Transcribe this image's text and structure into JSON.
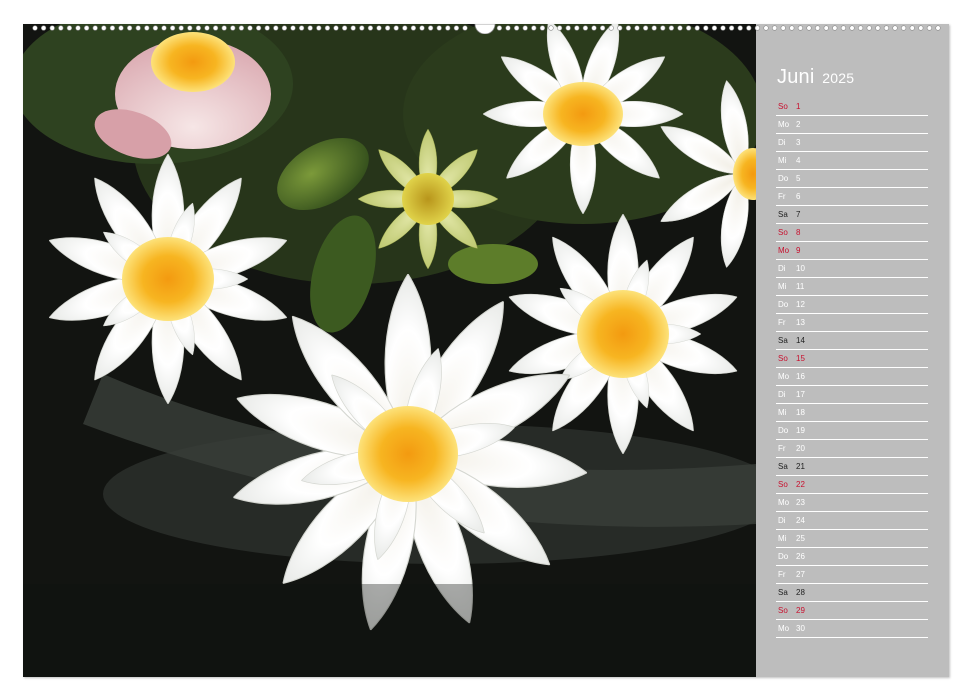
{
  "calendar": {
    "month": "Juni",
    "year": "2025",
    "days": [
      {
        "wd": "So",
        "d": "1",
        "type": "sun"
      },
      {
        "wd": "Mo",
        "d": "2",
        "type": "day"
      },
      {
        "wd": "Di",
        "d": "3",
        "type": "day"
      },
      {
        "wd": "Mi",
        "d": "4",
        "type": "day"
      },
      {
        "wd": "Do",
        "d": "5",
        "type": "day"
      },
      {
        "wd": "Fr",
        "d": "6",
        "type": "day"
      },
      {
        "wd": "Sa",
        "d": "7",
        "type": "sat"
      },
      {
        "wd": "So",
        "d": "8",
        "type": "sun"
      },
      {
        "wd": "Mo",
        "d": "9",
        "type": "sun"
      },
      {
        "wd": "Di",
        "d": "10",
        "type": "day"
      },
      {
        "wd": "Mi",
        "d": "11",
        "type": "day"
      },
      {
        "wd": "Do",
        "d": "12",
        "type": "day"
      },
      {
        "wd": "Fr",
        "d": "13",
        "type": "day"
      },
      {
        "wd": "Sa",
        "d": "14",
        "type": "sat"
      },
      {
        "wd": "So",
        "d": "15",
        "type": "sun"
      },
      {
        "wd": "Mo",
        "d": "16",
        "type": "day"
      },
      {
        "wd": "Di",
        "d": "17",
        "type": "day"
      },
      {
        "wd": "Mi",
        "d": "18",
        "type": "day"
      },
      {
        "wd": "Do",
        "d": "19",
        "type": "day"
      },
      {
        "wd": "Fr",
        "d": "20",
        "type": "day"
      },
      {
        "wd": "Sa",
        "d": "21",
        "type": "sat"
      },
      {
        "wd": "So",
        "d": "22",
        "type": "sun"
      },
      {
        "wd": "Mo",
        "d": "23",
        "type": "day"
      },
      {
        "wd": "Di",
        "d": "24",
        "type": "day"
      },
      {
        "wd": "Mi",
        "d": "25",
        "type": "day"
      },
      {
        "wd": "Do",
        "d": "26",
        "type": "day"
      },
      {
        "wd": "Fr",
        "d": "27",
        "type": "day"
      },
      {
        "wd": "Sa",
        "d": "28",
        "type": "sat"
      },
      {
        "wd": "So",
        "d": "29",
        "type": "sun"
      },
      {
        "wd": "Mo",
        "d": "30",
        "type": "day"
      }
    ]
  },
  "colors": {
    "panel": "#bdbdbd",
    "sunday": "#c8102e",
    "saturday": "#1e1e1e",
    "weekday": "#ffffff"
  }
}
